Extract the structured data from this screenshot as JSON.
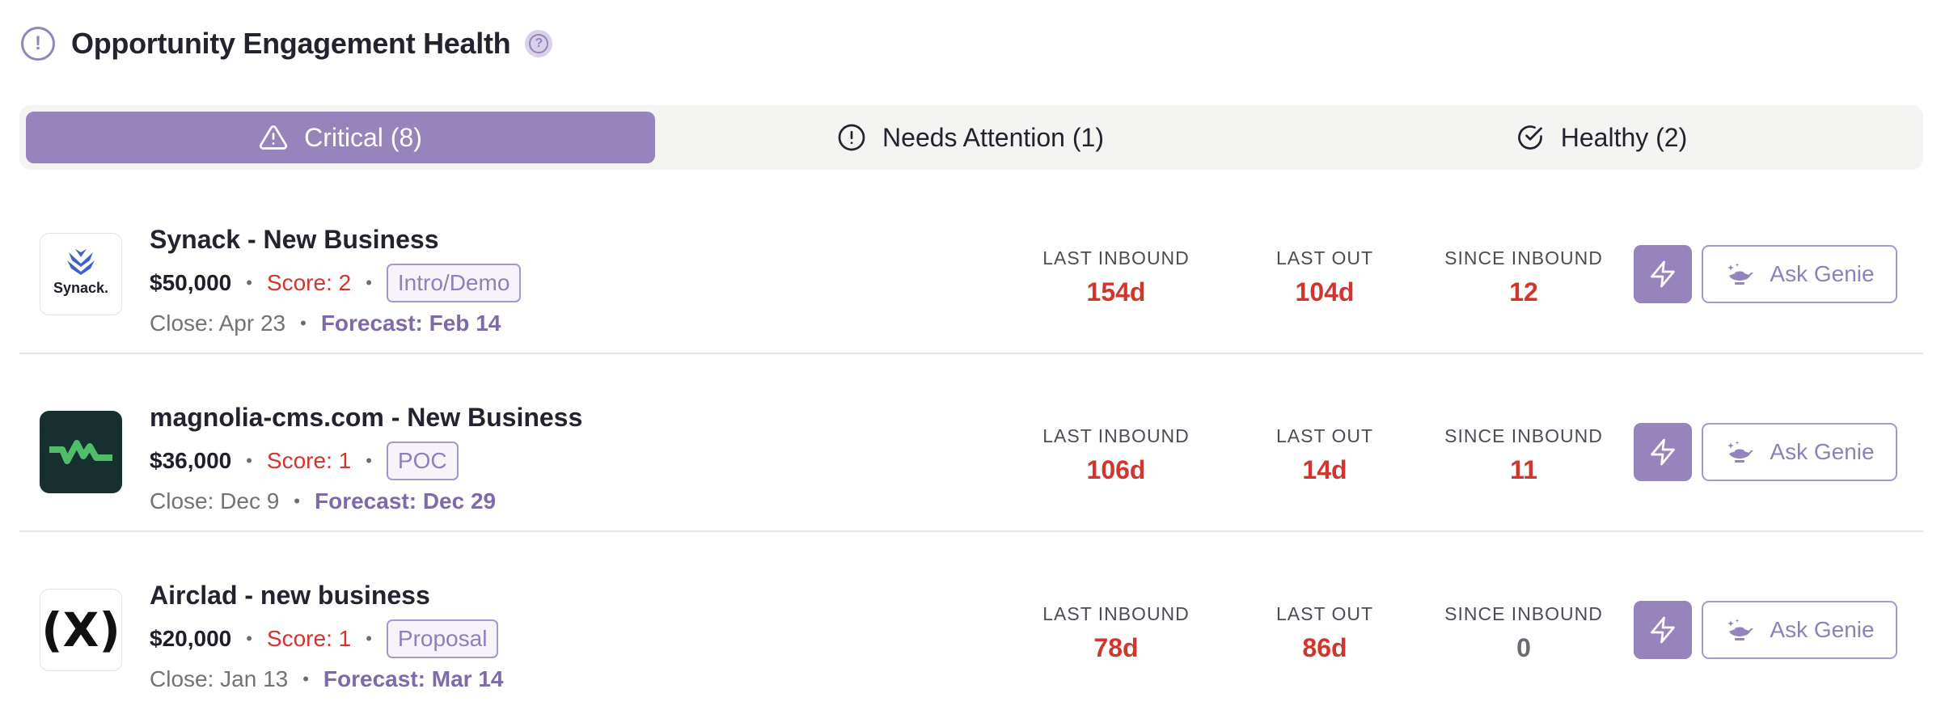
{
  "header": {
    "title": "Opportunity Engagement Health",
    "icon": "exclamation-circle-icon",
    "help_icon": "question-circle-icon"
  },
  "tabs": [
    {
      "label": "Critical (8)",
      "icon": "warning-triangle-icon",
      "active": true
    },
    {
      "label": "Needs Attention (1)",
      "icon": "exclamation-circle-icon",
      "active": false
    },
    {
      "label": "Healthy (2)",
      "icon": "check-circle-icon",
      "active": false
    }
  ],
  "metric_labels": {
    "last_inbound": "LAST INBOUND",
    "last_out": "LAST OUT",
    "since_inbound": "SINCE INBOUND"
  },
  "ask_genie_label": "Ask Genie",
  "opportunities": [
    {
      "name": "Synack - New Business",
      "logo_text": "Synack.",
      "amount": "$50,000",
      "score": "Score: 2",
      "stage": "Intro/Demo",
      "close": "Close: Apr 23",
      "forecast": "Forecast: Feb 14",
      "last_inbound": "154d",
      "last_out": "104d",
      "since_inbound": "12"
    },
    {
      "name": "magnolia-cms.com - New Business",
      "logo_text": "",
      "amount": "$36,000",
      "score": "Score: 1",
      "stage": "POC",
      "close": "Close: Dec 9",
      "forecast": "Forecast: Dec 29",
      "last_inbound": "106d",
      "last_out": "14d",
      "since_inbound": "11"
    },
    {
      "name": "Airclad - new business",
      "logo_text": "(X)",
      "amount": "$20,000",
      "score": "Score: 1",
      "stage": "Proposal",
      "close": "Close: Jan 13",
      "forecast": "Forecast: Mar 14",
      "last_inbound": "78d",
      "last_out": "86d",
      "since_inbound": "0"
    }
  ],
  "colors": {
    "accent": "#9784bd",
    "critical_red": "#d1352e",
    "forecast_purple": "#7e6aaa"
  }
}
